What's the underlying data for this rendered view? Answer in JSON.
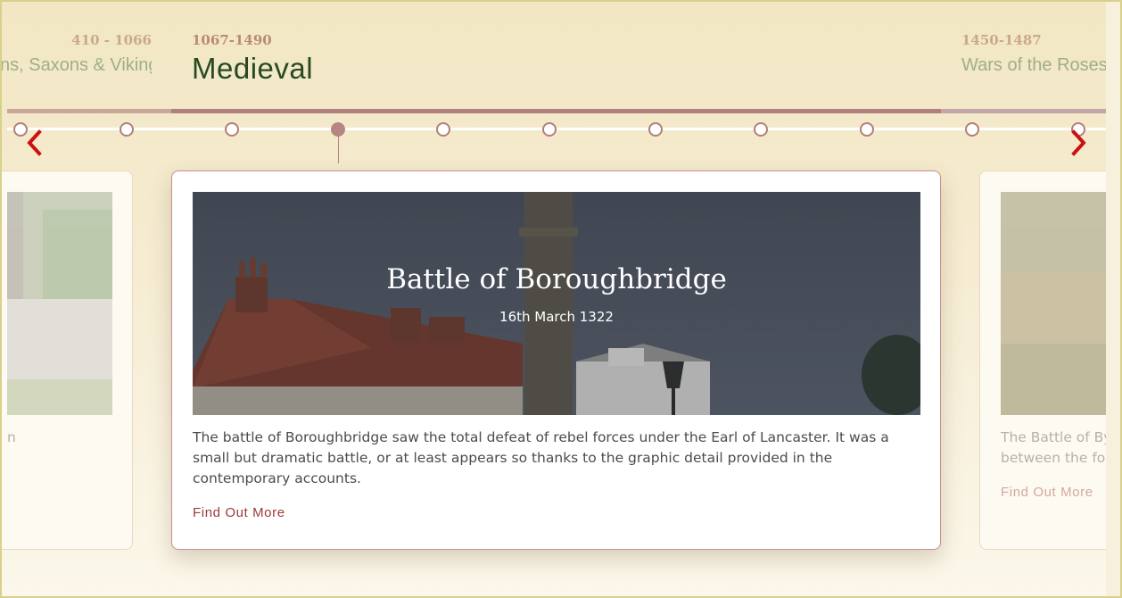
{
  "eras": {
    "prev": {
      "years": "410 - 1066",
      "name": "ns, Saxons & Vikings"
    },
    "current": {
      "years": "1067-1490",
      "name": "Medieval"
    },
    "next": {
      "years": "1450-1487",
      "name": "Wars of the Roses"
    }
  },
  "timeline": {
    "dots_count": 11,
    "selected_index": 3
  },
  "main_card": {
    "title": "Battle of Boroughbridge",
    "date": "16th March 1322",
    "description": "The battle of Boroughbridge saw the total defeat of rebel forces under the Earl of Lancaster. It was a small but dramatic battle, or at least appears so thanks to the graphic detail provided in the contemporary accounts.",
    "link": "Find Out More"
  },
  "left_card": {
    "text": "n"
  },
  "right_card": {
    "text_line1": "The Battle of By",
    "text_line2": "between the for",
    "link": "Find Out More"
  },
  "colors": {
    "accent": "#9b3a3a",
    "arrow": "#cc1111",
    "era_active": "#274a22",
    "timeline_band": "#b08080"
  }
}
